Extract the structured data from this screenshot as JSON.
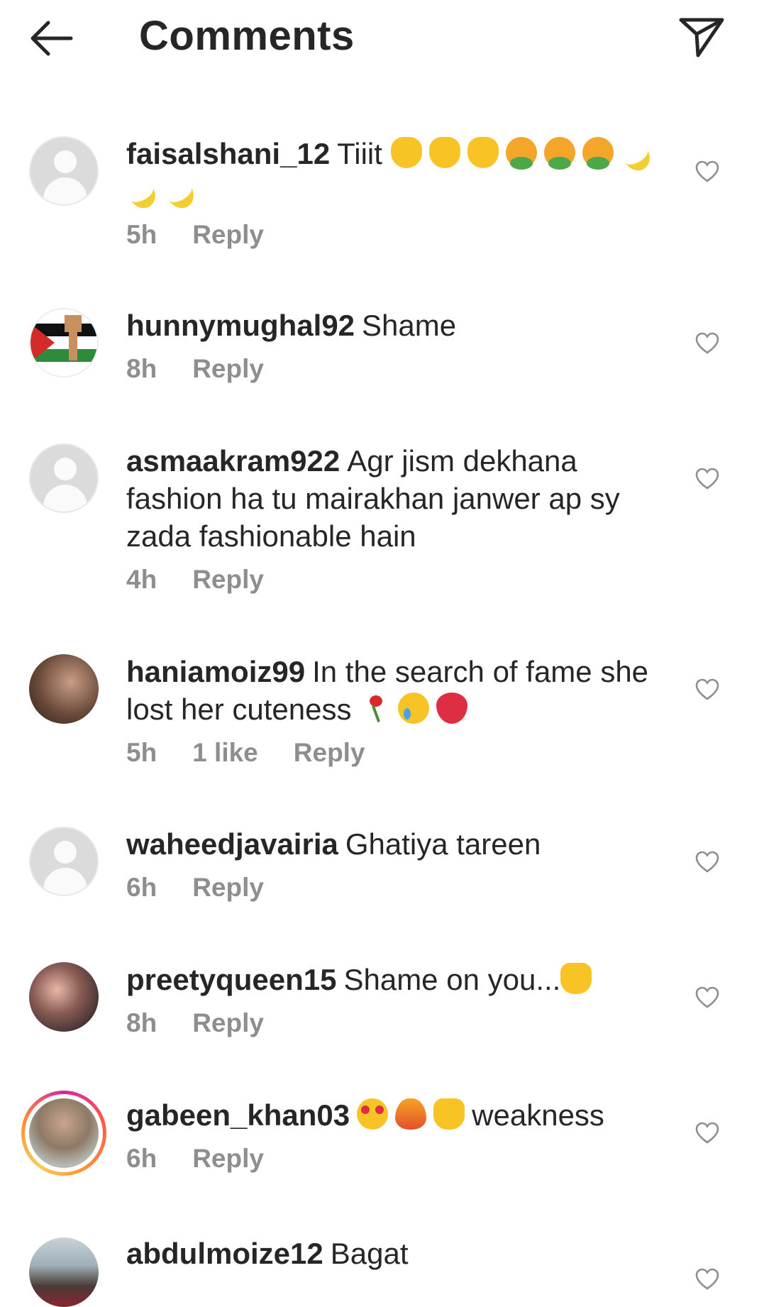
{
  "header": {
    "title": "Comments",
    "back_icon": "arrow-left-icon",
    "share_icon": "paper-plane-icon"
  },
  "comments": [
    {
      "username": "faisalshani_12",
      "text": "Tiiit",
      "emojis": [
        "clap",
        "clap",
        "clap",
        "vomit",
        "vomit",
        "vomit",
        "banana",
        "banana",
        "banana"
      ],
      "time": "5h",
      "likes": "",
      "reply": "Reply",
      "avatar": "default-avatar"
    },
    {
      "username": "hunnymughal92",
      "text": "Shame",
      "emojis": [],
      "time": "8h",
      "likes": "",
      "reply": "Reply",
      "avatar": "flag-fist-avatar"
    },
    {
      "username": "asmaakram922",
      "text": "Agr jism dekhana fashion ha tu mairakhan janwer ap sy zada fashionable hain",
      "emojis": [],
      "time": "4h",
      "likes": "",
      "reply": "Reply",
      "avatar": "default-avatar"
    },
    {
      "username": "haniamoiz99",
      "text": "In the search of fame she lost her cuteness",
      "emojis": [
        "rose",
        "cry",
        "broken"
      ],
      "time": "5h",
      "likes": "1 like",
      "reply": "Reply",
      "avatar": "photo-avatar"
    },
    {
      "username": "waheedjavairia",
      "text": "Ghatiya tareen",
      "emojis": [],
      "time": "6h",
      "likes": "",
      "reply": "Reply",
      "avatar": "default-avatar"
    },
    {
      "username": "preetyqueen15",
      "text": "Shame on you...",
      "emojis": [
        "hand"
      ],
      "time": "8h",
      "likes": "",
      "reply": "Reply",
      "avatar": "photo-avatar"
    },
    {
      "username": "gabeen_khan03",
      "text": "weakness",
      "emojis_before": [
        "hearteyes",
        "fire",
        "raise"
      ],
      "time": "6h",
      "likes": "",
      "reply": "Reply",
      "avatar": "story-avatar"
    },
    {
      "username": "abdulmoize12",
      "text": "Bagat",
      "emojis": [],
      "time": "",
      "likes": "",
      "reply": "",
      "avatar": "photo-avatar"
    }
  ],
  "colors": {
    "text": "#262626",
    "meta": "#8e8e8e",
    "background": "#ffffff"
  }
}
